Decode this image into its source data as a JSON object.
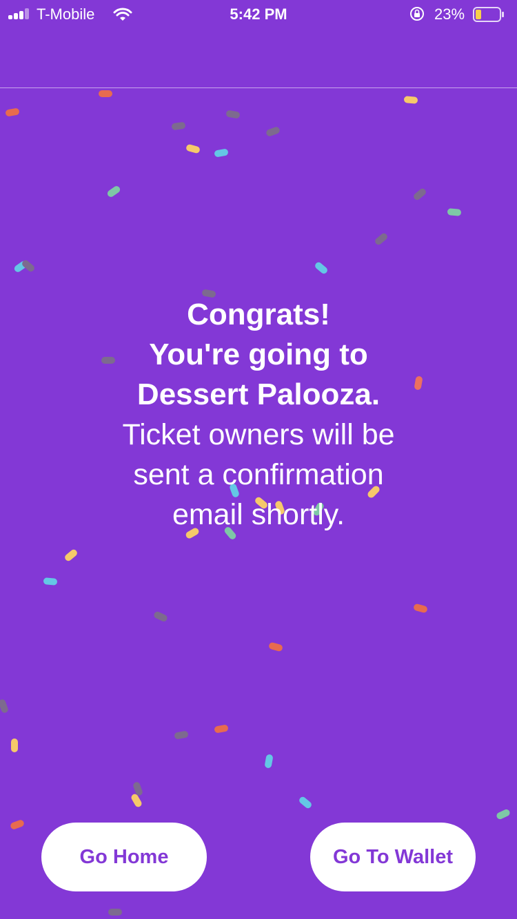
{
  "status_bar": {
    "carrier": "T-Mobile",
    "time": "5:42 PM",
    "battery_percent": "23%",
    "battery_level": 0.23
  },
  "message": {
    "line1": "Congrats!",
    "line2": "You're going to",
    "line3": "Dessert Palooza.",
    "sub1": "Ticket owners will be",
    "sub2": "sent a confirmation",
    "sub3": "email shortly."
  },
  "buttons": {
    "home_label": "Go Home",
    "wallet_label": "Go To Wallet"
  },
  "colors": {
    "background": "#8338d6",
    "button_bg": "#ffffff",
    "button_text": "#8338d6",
    "confetti": [
      "#e86b4f",
      "#7d6a8f",
      "#f6c96a",
      "#64c7e5",
      "#7ec8a6",
      "#ec7060"
    ]
  }
}
